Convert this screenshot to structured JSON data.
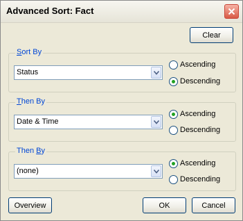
{
  "window": {
    "title": "Advanced Sort: Fact"
  },
  "toolbar": {
    "clear_label": "Clear"
  },
  "groups": [
    {
      "label_prefix": "",
      "label_key": "S",
      "label_rest": "ort By",
      "value": "Status",
      "selected": "descending"
    },
    {
      "label_prefix": "",
      "label_key": "T",
      "label_rest": "hen By",
      "value": "Date & Time",
      "selected": "ascending"
    },
    {
      "label_prefix": "Then ",
      "label_key": "B",
      "label_rest": "y",
      "value": "(none)",
      "selected": "ascending"
    }
  ],
  "options": {
    "ascending": "Ascending",
    "descending": "Descending"
  },
  "footer": {
    "overview_label": "Overview",
    "ok_label": "OK",
    "cancel_label": "Cancel"
  },
  "colors": {
    "accent": "#0046d5",
    "radio_checked": "#21a121",
    "close": "#d85a45"
  },
  "icons": {
    "close": "close-icon",
    "dropdown": "chevron-down-icon"
  }
}
